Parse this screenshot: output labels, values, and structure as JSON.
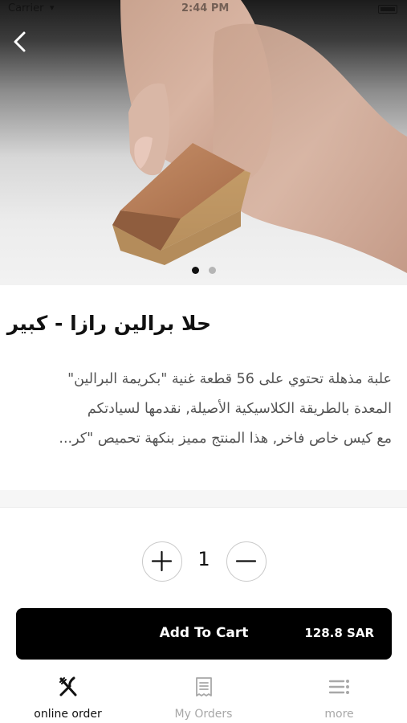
{
  "status_bar": {
    "carrier": "Carrier",
    "time": "2:44 PM"
  },
  "hero": {
    "slide_count": 2,
    "active_slide": 1
  },
  "product": {
    "title": "حلا برالين رازا - كبير",
    "description_lines": [
      "علبة مذهلة تحتوي على 56 قطعة غنية \"بكريمة البرالين\"",
      "المعدة بالطريقة الكلاسيكية الأصيلة, نقدمها لسيادتكم",
      "مع كيس خاص فاخر, هذا المنتج مميز بنكهة تحميص \"كر..."
    ]
  },
  "quantity": {
    "value": "1"
  },
  "cart_button": {
    "label": "Add To Cart",
    "price": "128.8 SAR"
  },
  "tabs": [
    {
      "label": "online order",
      "icon": "fork-knife-icon",
      "active": true
    },
    {
      "label": "My Orders",
      "icon": "receipt-icon",
      "active": false
    },
    {
      "label": "more",
      "icon": "menu-list-icon",
      "active": false
    }
  ],
  "colors": {
    "primary": "#000000",
    "text_secondary": "#545454",
    "tab_inactive": "#a8a8a8"
  }
}
